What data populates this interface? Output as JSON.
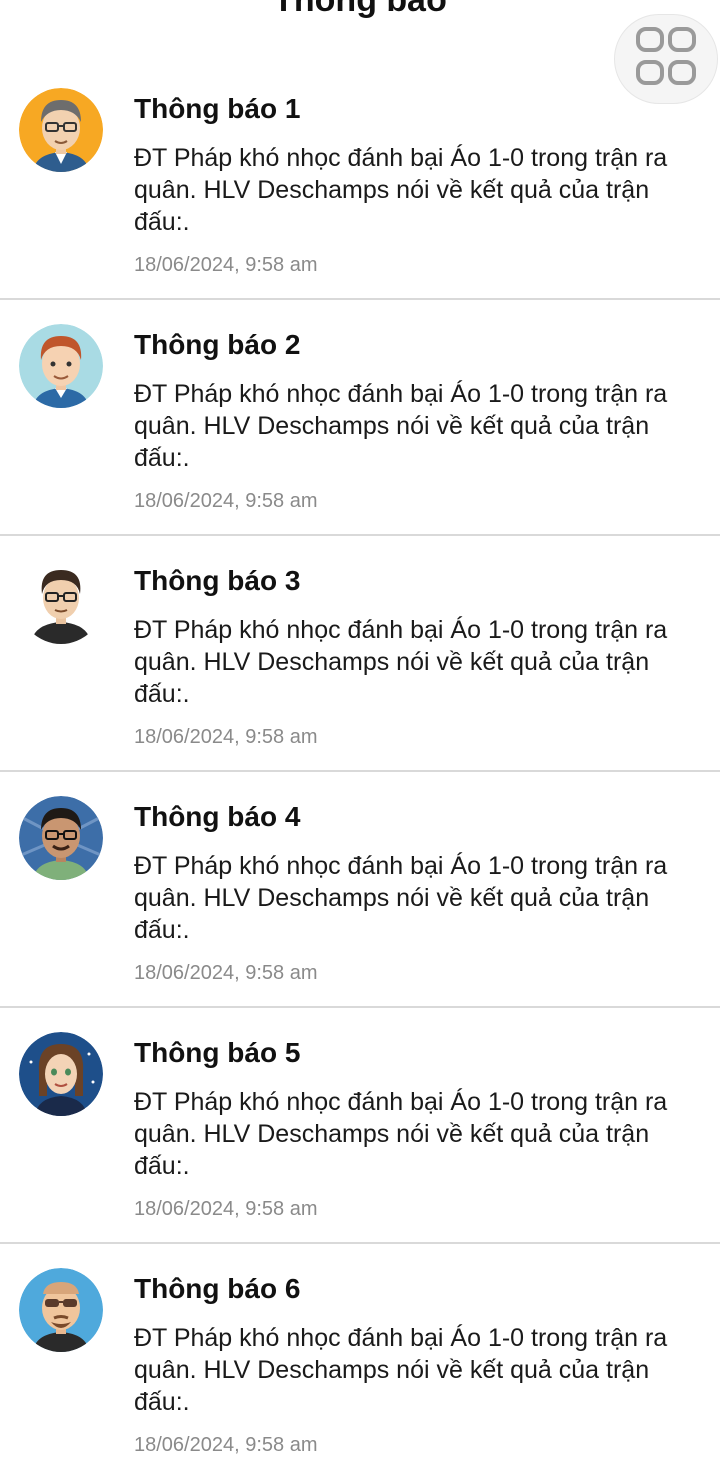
{
  "header": {
    "title": "Thông báo",
    "menu_icon": "grid-icon"
  },
  "notifications": [
    {
      "title": "Thông báo 1",
      "body": "ĐT Pháp khó nhọc đánh bại Áo 1-0 trong trận ra quân. HLV Deschamps nói về kết quả của trận đấu:.",
      "time": "18/06/2024, 9:58 am",
      "avatar_bg": "#f7a823"
    },
    {
      "title": "Thông báo 2",
      "body": "ĐT Pháp khó nhọc đánh bại Áo 1-0 trong trận ra quân. HLV Deschamps nói về kết quả của trận đấu:.",
      "time": "18/06/2024, 9:58 am",
      "avatar_bg": "#a9dbe4"
    },
    {
      "title": "Thông báo 3",
      "body": "ĐT Pháp khó nhọc đánh bại Áo 1-0 trong trận ra quân. HLV Deschamps nói về kết quả của trận đấu:.",
      "time": "18/06/2024, 9:58 am",
      "avatar_bg": "#ffffff"
    },
    {
      "title": "Thông báo 4",
      "body": "ĐT Pháp khó nhọc đánh bại Áo 1-0 trong trận ra quân. HLV Deschamps nói về kết quả của trận đấu:.",
      "time": "18/06/2024, 9:58 am",
      "avatar_bg": "#3d6ea8"
    },
    {
      "title": "Thông báo 5",
      "body": "ĐT Pháp khó nhọc đánh bại Áo 1-0 trong trận ra quân. HLV Deschamps nói về kết quả của trận đấu:.",
      "time": "18/06/2024, 9:58 am",
      "avatar_bg": "#1e4f8a"
    },
    {
      "title": "Thông báo 6",
      "body": "ĐT Pháp khó nhọc đánh bại Áo 1-0 trong trận ra quân. HLV Deschamps nói về kết quả của trận đấu:.",
      "time": "18/06/2024, 9:58 am",
      "avatar_bg": "#4fa9dc"
    }
  ]
}
